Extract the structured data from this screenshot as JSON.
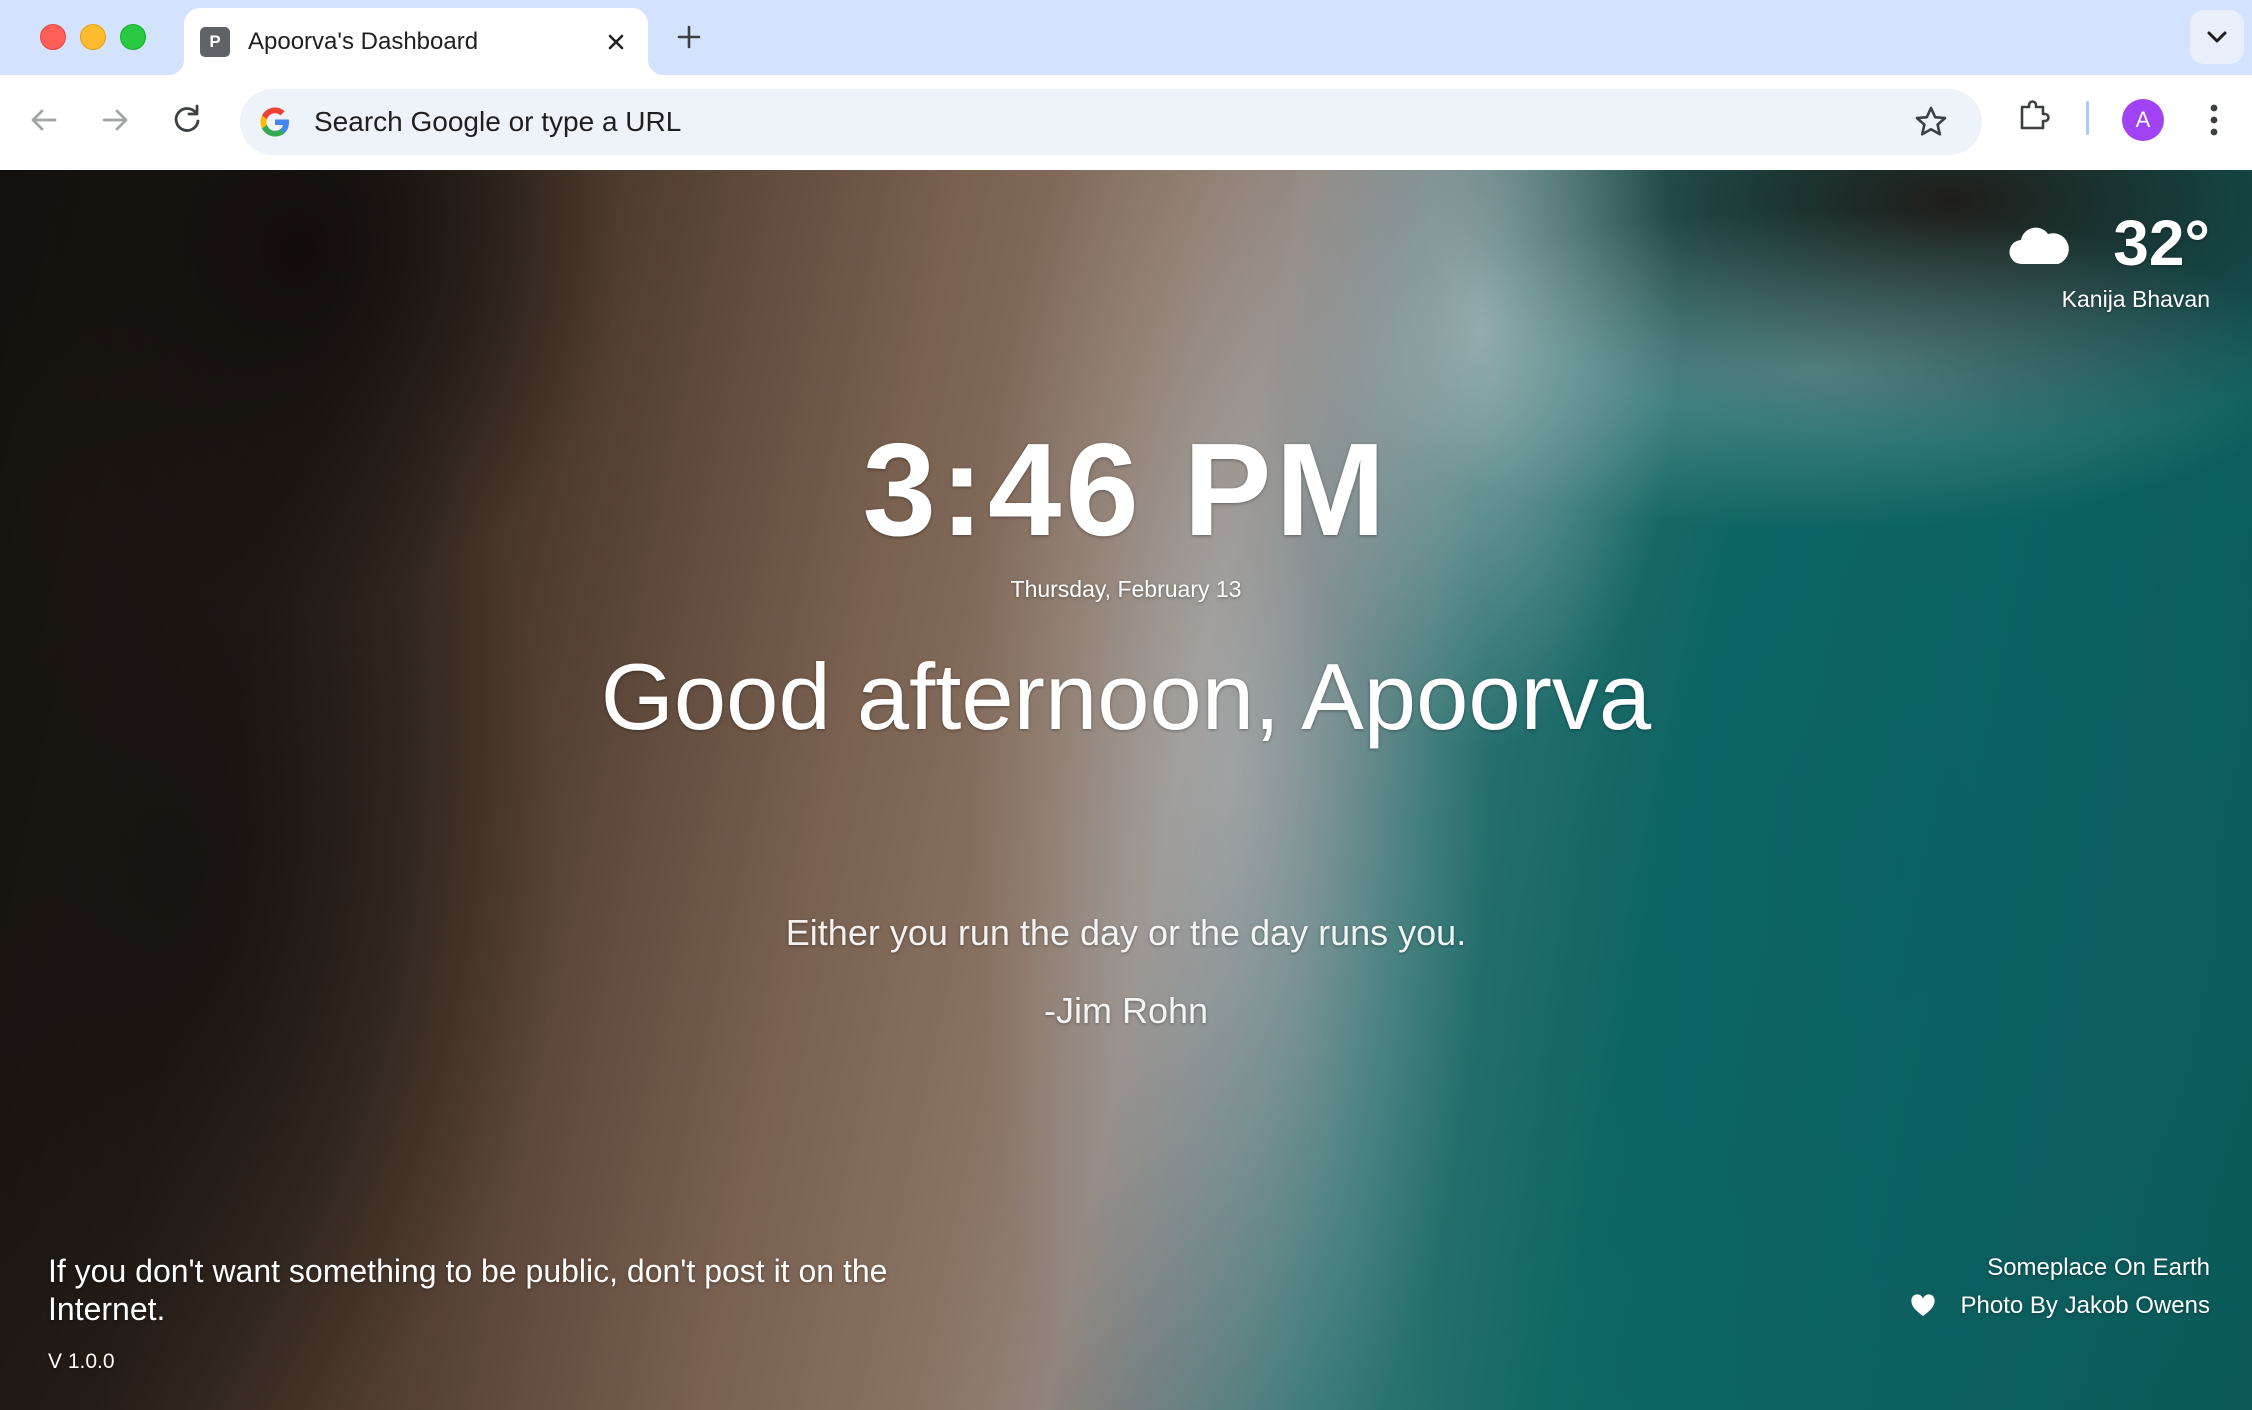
{
  "window": {
    "tab": {
      "favicon_letter": "P",
      "title": "Apoorva's Dashboard"
    }
  },
  "toolbar": {
    "omnibox_placeholder": "Search Google or type a URL",
    "profile_initial": "A"
  },
  "dashboard": {
    "weather": {
      "icon": "cloud-icon",
      "temperature": "32°",
      "location": "Kanija Bhavan"
    },
    "time": "3:46 PM",
    "date": "Thursday, February 13",
    "greeting": "Good afternoon, Apoorva",
    "quote": {
      "text": "Either you run the day or the day runs you.",
      "author": "-Jim Rohn"
    },
    "footer_quote": "If you don't want something to be public, don't post it on the Internet.",
    "version": "V 1.0.0",
    "photo": {
      "location": "Someplace On Earth",
      "credit": "Photo By Jakob Owens"
    }
  },
  "colors": {
    "tabstrip": "#d3e3fd",
    "omnibox": "#eef2f9",
    "avatar": "#a142f4"
  }
}
